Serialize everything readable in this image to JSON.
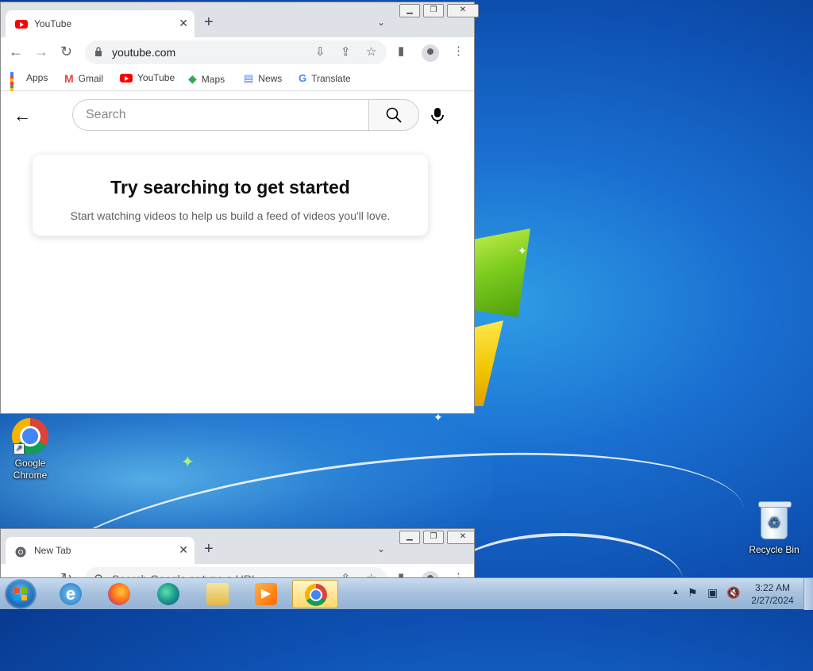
{
  "main_window": {
    "tab": {
      "title": "YouTube"
    },
    "omnibox": {
      "url": "youtube.com"
    },
    "bookmarks": [
      {
        "label": "Apps",
        "icon": "apps-grid-icon"
      },
      {
        "label": "Gmail",
        "icon": "gmail-icon"
      },
      {
        "label": "YouTube",
        "icon": "youtube-icon"
      },
      {
        "label": "Maps",
        "icon": "maps-icon"
      },
      {
        "label": "News",
        "icon": "news-icon"
      },
      {
        "label": "Translate",
        "icon": "translate-icon"
      }
    ],
    "content": {
      "search_placeholder": "Search",
      "heading": "Try searching to get started",
      "subtext": "Start watching videos to help us build a feed of videos you'll love."
    }
  },
  "second_window": {
    "tab": {
      "title": "New Tab"
    },
    "omnibox": {
      "placeholder": "Search Google or type a URL"
    }
  },
  "desktop": {
    "icons": [
      {
        "label_line1": "Google",
        "label_line2": "Chrome"
      },
      {
        "label": "Recycle Bin"
      }
    ]
  },
  "taskbar": {
    "apps": [
      "internet-explorer-icon",
      "firefox-icon",
      "edge-icon",
      "file-explorer-icon",
      "media-player-icon",
      "chrome-icon"
    ],
    "clock": {
      "time": "3:22 AM",
      "date": "2/27/2024"
    }
  },
  "colors": {
    "youtube_red": "#ff0000",
    "chrome_tab_bg": "#dee1e6",
    "taskbar": "#a9c3df"
  }
}
